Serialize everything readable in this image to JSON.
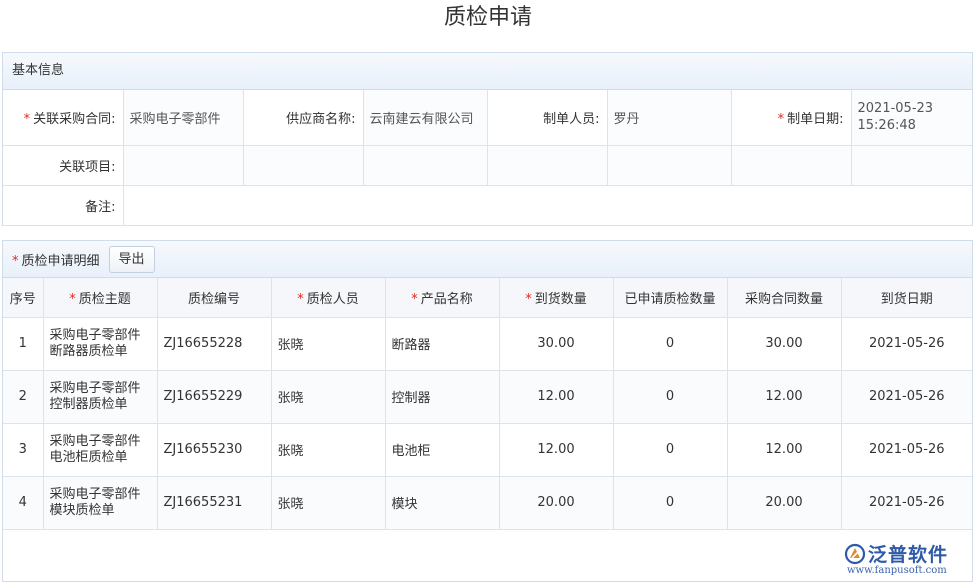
{
  "page": {
    "title": "质检申请"
  },
  "basic": {
    "header": "基本信息",
    "contract_label": "关联采购合同:",
    "contract_value": "采购电子零部件",
    "supplier_label": "供应商名称:",
    "supplier_value": "云南建云有限公司",
    "maker_label": "制单人员:",
    "maker_value": "罗丹",
    "date_label": "制单日期:",
    "date_value_line1": "2021-05-23",
    "date_value_line2": "15:26:48",
    "project_label": "关联项目:",
    "remark_label": "备注:"
  },
  "detail": {
    "header": "质检申请明细",
    "export_label": "导出",
    "columns": {
      "seq": "序号",
      "subject": "质检主题",
      "code": "质检编号",
      "inspector": "质检人员",
      "product": "产品名称",
      "arrival_qty": "到货数量",
      "applied_qty": "已申请质检数量",
      "contract_qty": "采购合同数量",
      "arrival_date": "到货日期"
    },
    "rows": [
      {
        "seq": "1",
        "subject1": "采购电子零部件",
        "subject2": "断路器质检单",
        "code": "ZJ16655228",
        "inspector": "张晓",
        "product": "断路器",
        "arrival_qty": "30.00",
        "applied_qty": "0",
        "contract_qty": "30.00",
        "arrival_date": "2021-05-26"
      },
      {
        "seq": "2",
        "subject1": "采购电子零部件",
        "subject2": "控制器质检单",
        "code": "ZJ16655229",
        "inspector": "张晓",
        "product": "控制器",
        "arrival_qty": "12.00",
        "applied_qty": "0",
        "contract_qty": "12.00",
        "arrival_date": "2021-05-26"
      },
      {
        "seq": "3",
        "subject1": "采购电子零部件",
        "subject2": "电池柜质检单",
        "code": "ZJ16655230",
        "inspector": "张晓",
        "product": "电池柜",
        "arrival_qty": "12.00",
        "applied_qty": "0",
        "contract_qty": "12.00",
        "arrival_date": "2021-05-26"
      },
      {
        "seq": "4",
        "subject1": "采购电子零部件",
        "subject2": "模块质检单",
        "code": "ZJ16655231",
        "inspector": "张晓",
        "product": "模块",
        "arrival_qty": "20.00",
        "applied_qty": "0",
        "contract_qty": "20.00",
        "arrival_date": "2021-05-26"
      }
    ]
  },
  "watermark": {
    "name": "泛普软件",
    "url": "www.fanpusoft.com"
  },
  "colors": {
    "required": "#e0281e",
    "border": "#cfdcec",
    "brand": "#2f5aa8"
  }
}
